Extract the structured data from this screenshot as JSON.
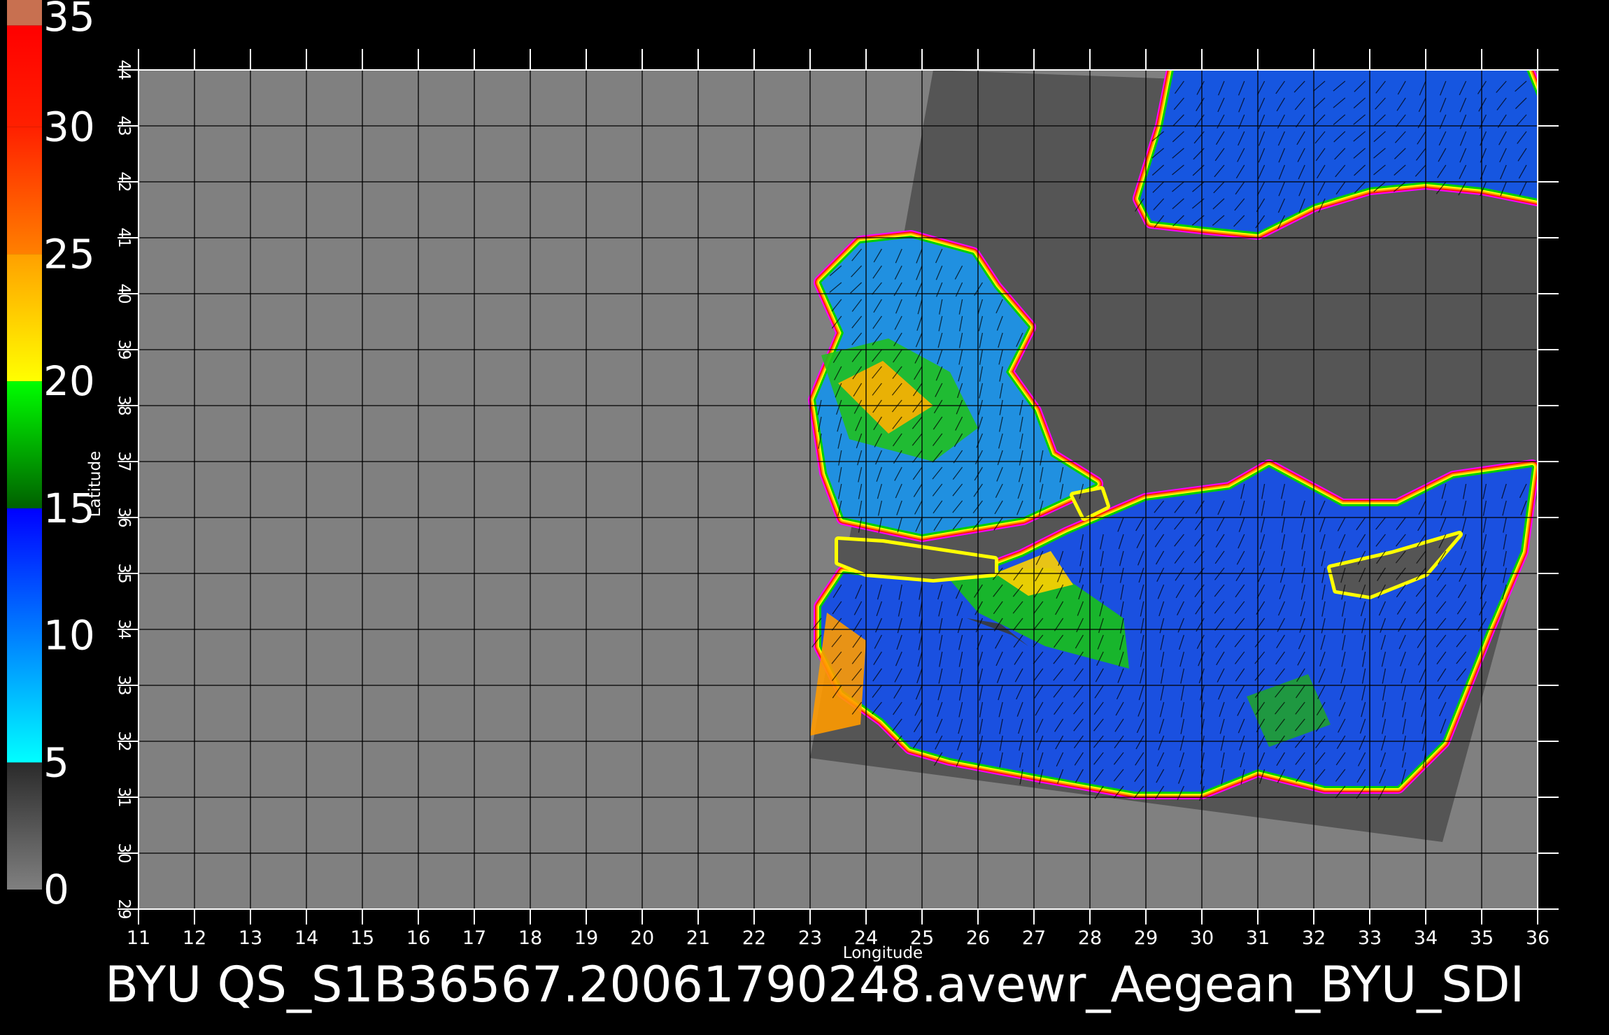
{
  "title": "BYU  QS_S1B36567.20061790248.avewr_Aegean_BYU_SDI",
  "colorbar": {
    "labels": [
      "0",
      "5",
      "10",
      "15",
      "20",
      "25",
      "30",
      "35"
    ],
    "min": 0,
    "max": 35,
    "bands": [
      {
        "from": 0,
        "to": 5,
        "colors": [
          "#808080",
          "#2a2a2a"
        ]
      },
      {
        "from": 5,
        "to": 15,
        "colors": [
          "#00ffff",
          "#0000ff"
        ]
      },
      {
        "from": 15,
        "to": 20,
        "colors": [
          "#006000",
          "#00ff00"
        ]
      },
      {
        "from": 20,
        "to": 25,
        "colors": [
          "#ffff00",
          "#ffa000"
        ]
      },
      {
        "from": 25,
        "to": 30,
        "colors": [
          "#ff8000",
          "#ff2000"
        ]
      },
      {
        "from": 30,
        "to": 34,
        "colors": [
          "#ff2000",
          "#ff0000"
        ]
      },
      {
        "from": 34,
        "to": 35,
        "colors": [
          "#c87050",
          "#c87050"
        ]
      }
    ]
  },
  "map": {
    "xlabel": "Longitude",
    "ylabel": "Latitude",
    "lon_range": [
      11,
      36
    ],
    "lat_range": [
      29,
      44
    ],
    "lon_ticks": [
      "11",
      "12",
      "13",
      "14",
      "15",
      "16",
      "17",
      "18",
      "19",
      "20",
      "21",
      "22",
      "23",
      "24",
      "25",
      "26",
      "27",
      "28",
      "29",
      "30",
      "31",
      "32",
      "33",
      "34",
      "35",
      "36"
    ],
    "lat_ticks": [
      "29",
      "30",
      "31",
      "32",
      "33",
      "34",
      "35",
      "36",
      "37",
      "38",
      "39",
      "40",
      "41",
      "42",
      "43",
      "44"
    ],
    "grid": true,
    "colors": {
      "background": "#000000",
      "no_data": "#808080",
      "land": "#555555",
      "grid": "#000000",
      "frame": "#ffffff"
    },
    "swath_corners_lonlat": [
      [
        25.2,
        44.0
      ],
      [
        36.0,
        43.6
      ],
      [
        36.0,
        36.4
      ],
      [
        34.3,
        30.2
      ],
      [
        23.0,
        31.7
      ]
    ],
    "ocean_regions": [
      {
        "name": "black-sea",
        "lonlat": [
          [
            28.9,
            41.7
          ],
          [
            29.3,
            43.0
          ],
          [
            29.5,
            44.0
          ],
          [
            35.8,
            44.0
          ],
          [
            36.0,
            43.5
          ],
          [
            36.0,
            41.7
          ],
          [
            35.0,
            41.9
          ],
          [
            34.0,
            42.0
          ],
          [
            33.0,
            41.9
          ],
          [
            32.0,
            41.6
          ],
          [
            31.0,
            41.1
          ],
          [
            30.0,
            41.2
          ],
          [
            29.1,
            41.3
          ]
        ],
        "color": "#1656e0"
      },
      {
        "name": "aegean-sea",
        "lonlat": [
          [
            23.9,
            40.9
          ],
          [
            24.8,
            41.0
          ],
          [
            25.9,
            40.7
          ],
          [
            26.3,
            40.1
          ],
          [
            26.9,
            39.4
          ],
          [
            26.5,
            38.6
          ],
          [
            27.0,
            37.9
          ],
          [
            27.3,
            37.1
          ],
          [
            28.1,
            36.6
          ],
          [
            26.8,
            36.0
          ],
          [
            25.0,
            35.7
          ],
          [
            23.6,
            36.0
          ],
          [
            23.3,
            36.8
          ],
          [
            23.1,
            38.1
          ],
          [
            23.6,
            39.3
          ],
          [
            23.2,
            40.2
          ]
        ],
        "color": "#2090e0"
      },
      {
        "name": "levantine-sea",
        "lonlat": [
          [
            23.6,
            35.0
          ],
          [
            24.5,
            34.9
          ],
          [
            26.0,
            35.0
          ],
          [
            26.8,
            35.3
          ],
          [
            27.6,
            35.7
          ],
          [
            29.0,
            36.3
          ],
          [
            30.5,
            36.5
          ],
          [
            31.2,
            36.9
          ],
          [
            32.5,
            36.2
          ],
          [
            33.5,
            36.2
          ],
          [
            34.5,
            36.7
          ],
          [
            35.9,
            36.9
          ],
          [
            35.7,
            35.4
          ],
          [
            35.1,
            34.0
          ],
          [
            34.7,
            33.0
          ],
          [
            34.3,
            32.0
          ],
          [
            33.5,
            31.2
          ],
          [
            32.2,
            31.2
          ],
          [
            31.0,
            31.5
          ],
          [
            30.0,
            31.1
          ],
          [
            28.8,
            31.1
          ],
          [
            27.1,
            31.4
          ],
          [
            25.5,
            31.7
          ],
          [
            24.8,
            31.9
          ],
          [
            24.3,
            32.4
          ],
          [
            23.6,
            32.9
          ],
          [
            23.2,
            33.7
          ],
          [
            23.2,
            34.4
          ]
        ],
        "color": "#1a50e0"
      }
    ],
    "wind_patches": [
      {
        "speed_band": "20-25",
        "lonlat": [
          [
            23.0,
            32.1
          ],
          [
            23.9,
            32.3
          ],
          [
            24.0,
            33.8
          ],
          [
            23.3,
            34.3
          ]
        ],
        "color": "#ff9a00"
      },
      {
        "speed_band": "15-20",
        "lonlat": [
          [
            25.4,
            35.0
          ],
          [
            27.3,
            35.1
          ],
          [
            28.6,
            34.2
          ],
          [
            28.7,
            33.3
          ],
          [
            27.2,
            33.7
          ],
          [
            26.0,
            34.3
          ]
        ],
        "color": "#18c018"
      },
      {
        "speed_band": "20-25",
        "lonlat": [
          [
            26.3,
            35.0
          ],
          [
            27.3,
            35.4
          ],
          [
            27.7,
            34.8
          ],
          [
            26.9,
            34.6
          ]
        ],
        "color": "#ffd000"
      },
      {
        "speed_band": "15-20",
        "lonlat": [
          [
            23.2,
            38.9
          ],
          [
            24.4,
            39.2
          ],
          [
            25.5,
            38.6
          ],
          [
            26.0,
            37.6
          ],
          [
            25.2,
            37.0
          ],
          [
            23.7,
            37.4
          ]
        ],
        "color": "#20c020"
      },
      {
        "speed_band": "20-25",
        "lonlat": [
          [
            23.5,
            38.4
          ],
          [
            24.3,
            38.8
          ],
          [
            25.2,
            38.0
          ],
          [
            24.4,
            37.5
          ]
        ],
        "color": "#ffb000"
      },
      {
        "speed_band": "15-20",
        "lonlat": [
          [
            30.8,
            32.8
          ],
          [
            31.9,
            33.2
          ],
          [
            32.3,
            32.3
          ],
          [
            31.2,
            31.9
          ]
        ],
        "color": "#20a030"
      },
      {
        "speed_band": "0-5",
        "lonlat": [
          [
            25.8,
            34.2
          ],
          [
            26.6,
            33.9
          ],
          [
            26.9,
            33.7
          ],
          [
            26.4,
            34.1
          ]
        ],
        "color": "#3a3a3a"
      }
    ],
    "land_masses": [
      {
        "name": "crete",
        "lonlat": [
          [
            23.5,
            35.6
          ],
          [
            24.3,
            35.55
          ],
          [
            25.3,
            35.4
          ],
          [
            26.3,
            35.25
          ],
          [
            26.3,
            35.0
          ],
          [
            25.2,
            34.9
          ],
          [
            24.0,
            35.0
          ],
          [
            23.5,
            35.2
          ]
        ]
      },
      {
        "name": "cyprus",
        "lonlat": [
          [
            32.3,
            35.1
          ],
          [
            33.4,
            35.35
          ],
          [
            34.6,
            35.7
          ],
          [
            34.0,
            35.0
          ],
          [
            33.0,
            34.6
          ],
          [
            32.4,
            34.7
          ]
        ]
      },
      {
        "name": "rhodes",
        "lonlat": [
          [
            27.7,
            36.4
          ],
          [
            28.2,
            36.5
          ],
          [
            28.3,
            36.2
          ],
          [
            27.9,
            36.0
          ]
        ]
      }
    ]
  }
}
